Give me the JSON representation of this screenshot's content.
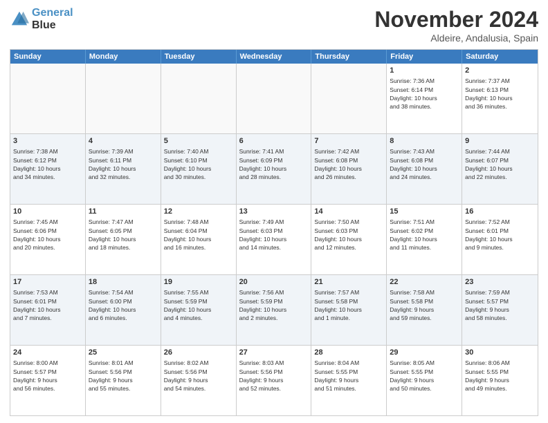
{
  "logo": {
    "line1": "General",
    "line2": "Blue"
  },
  "title": "November 2024",
  "location": "Aldeire, Andalusia, Spain",
  "header": {
    "days": [
      "Sunday",
      "Monday",
      "Tuesday",
      "Wednesday",
      "Thursday",
      "Friday",
      "Saturday"
    ]
  },
  "rows": [
    {
      "alt": false,
      "cells": [
        {
          "empty": true,
          "day": "",
          "text": ""
        },
        {
          "empty": true,
          "day": "",
          "text": ""
        },
        {
          "empty": true,
          "day": "",
          "text": ""
        },
        {
          "empty": true,
          "day": "",
          "text": ""
        },
        {
          "empty": true,
          "day": "",
          "text": ""
        },
        {
          "empty": false,
          "day": "1",
          "text": "Sunrise: 7:36 AM\nSunset: 6:14 PM\nDaylight: 10 hours\nand 38 minutes."
        },
        {
          "empty": false,
          "day": "2",
          "text": "Sunrise: 7:37 AM\nSunset: 6:13 PM\nDaylight: 10 hours\nand 36 minutes."
        }
      ]
    },
    {
      "alt": true,
      "cells": [
        {
          "empty": false,
          "day": "3",
          "text": "Sunrise: 7:38 AM\nSunset: 6:12 PM\nDaylight: 10 hours\nand 34 minutes."
        },
        {
          "empty": false,
          "day": "4",
          "text": "Sunrise: 7:39 AM\nSunset: 6:11 PM\nDaylight: 10 hours\nand 32 minutes."
        },
        {
          "empty": false,
          "day": "5",
          "text": "Sunrise: 7:40 AM\nSunset: 6:10 PM\nDaylight: 10 hours\nand 30 minutes."
        },
        {
          "empty": false,
          "day": "6",
          "text": "Sunrise: 7:41 AM\nSunset: 6:09 PM\nDaylight: 10 hours\nand 28 minutes."
        },
        {
          "empty": false,
          "day": "7",
          "text": "Sunrise: 7:42 AM\nSunset: 6:08 PM\nDaylight: 10 hours\nand 26 minutes."
        },
        {
          "empty": false,
          "day": "8",
          "text": "Sunrise: 7:43 AM\nSunset: 6:08 PM\nDaylight: 10 hours\nand 24 minutes."
        },
        {
          "empty": false,
          "day": "9",
          "text": "Sunrise: 7:44 AM\nSunset: 6:07 PM\nDaylight: 10 hours\nand 22 minutes."
        }
      ]
    },
    {
      "alt": false,
      "cells": [
        {
          "empty": false,
          "day": "10",
          "text": "Sunrise: 7:45 AM\nSunset: 6:06 PM\nDaylight: 10 hours\nand 20 minutes."
        },
        {
          "empty": false,
          "day": "11",
          "text": "Sunrise: 7:47 AM\nSunset: 6:05 PM\nDaylight: 10 hours\nand 18 minutes."
        },
        {
          "empty": false,
          "day": "12",
          "text": "Sunrise: 7:48 AM\nSunset: 6:04 PM\nDaylight: 10 hours\nand 16 minutes."
        },
        {
          "empty": false,
          "day": "13",
          "text": "Sunrise: 7:49 AM\nSunset: 6:03 PM\nDaylight: 10 hours\nand 14 minutes."
        },
        {
          "empty": false,
          "day": "14",
          "text": "Sunrise: 7:50 AM\nSunset: 6:03 PM\nDaylight: 10 hours\nand 12 minutes."
        },
        {
          "empty": false,
          "day": "15",
          "text": "Sunrise: 7:51 AM\nSunset: 6:02 PM\nDaylight: 10 hours\nand 11 minutes."
        },
        {
          "empty": false,
          "day": "16",
          "text": "Sunrise: 7:52 AM\nSunset: 6:01 PM\nDaylight: 10 hours\nand 9 minutes."
        }
      ]
    },
    {
      "alt": true,
      "cells": [
        {
          "empty": false,
          "day": "17",
          "text": "Sunrise: 7:53 AM\nSunset: 6:01 PM\nDaylight: 10 hours\nand 7 minutes."
        },
        {
          "empty": false,
          "day": "18",
          "text": "Sunrise: 7:54 AM\nSunset: 6:00 PM\nDaylight: 10 hours\nand 6 minutes."
        },
        {
          "empty": false,
          "day": "19",
          "text": "Sunrise: 7:55 AM\nSunset: 5:59 PM\nDaylight: 10 hours\nand 4 minutes."
        },
        {
          "empty": false,
          "day": "20",
          "text": "Sunrise: 7:56 AM\nSunset: 5:59 PM\nDaylight: 10 hours\nand 2 minutes."
        },
        {
          "empty": false,
          "day": "21",
          "text": "Sunrise: 7:57 AM\nSunset: 5:58 PM\nDaylight: 10 hours\nand 1 minute."
        },
        {
          "empty": false,
          "day": "22",
          "text": "Sunrise: 7:58 AM\nSunset: 5:58 PM\nDaylight: 9 hours\nand 59 minutes."
        },
        {
          "empty": false,
          "day": "23",
          "text": "Sunrise: 7:59 AM\nSunset: 5:57 PM\nDaylight: 9 hours\nand 58 minutes."
        }
      ]
    },
    {
      "alt": false,
      "cells": [
        {
          "empty": false,
          "day": "24",
          "text": "Sunrise: 8:00 AM\nSunset: 5:57 PM\nDaylight: 9 hours\nand 56 minutes."
        },
        {
          "empty": false,
          "day": "25",
          "text": "Sunrise: 8:01 AM\nSunset: 5:56 PM\nDaylight: 9 hours\nand 55 minutes."
        },
        {
          "empty": false,
          "day": "26",
          "text": "Sunrise: 8:02 AM\nSunset: 5:56 PM\nDaylight: 9 hours\nand 54 minutes."
        },
        {
          "empty": false,
          "day": "27",
          "text": "Sunrise: 8:03 AM\nSunset: 5:56 PM\nDaylight: 9 hours\nand 52 minutes."
        },
        {
          "empty": false,
          "day": "28",
          "text": "Sunrise: 8:04 AM\nSunset: 5:55 PM\nDaylight: 9 hours\nand 51 minutes."
        },
        {
          "empty": false,
          "day": "29",
          "text": "Sunrise: 8:05 AM\nSunset: 5:55 PM\nDaylight: 9 hours\nand 50 minutes."
        },
        {
          "empty": false,
          "day": "30",
          "text": "Sunrise: 8:06 AM\nSunset: 5:55 PM\nDaylight: 9 hours\nand 49 minutes."
        }
      ]
    }
  ]
}
